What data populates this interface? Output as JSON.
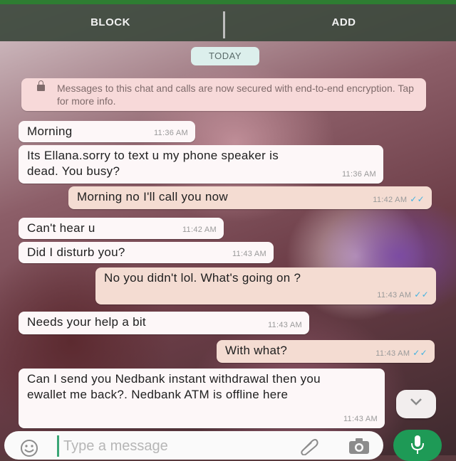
{
  "topbar": {
    "block_label": "BLOCK",
    "add_label": "ADD"
  },
  "date_chip": "TODAY",
  "encryption_notice": "Messages to this chat and calls are now secured with end-to-end encryption. Tap for more info.",
  "messages": [
    {
      "direction": "incoming",
      "text": "Morning",
      "time": "11:36 AM"
    },
    {
      "direction": "incoming",
      "text": "Its Ellana.sorry to text u my phone speaker is dead. You busy?",
      "time": "11:36 AM"
    },
    {
      "direction": "outgoing",
      "text": "Morning no I'll call you now",
      "time": "11:42 AM",
      "ticks": "✓✓"
    },
    {
      "direction": "incoming",
      "text": "Can't hear u",
      "time": "11:42 AM"
    },
    {
      "direction": "incoming",
      "text": "Did I disturb you?",
      "time": "11:43 AM"
    },
    {
      "direction": "outgoing",
      "text": "No you didn't lol. What's going on ?",
      "time": "11:43 AM",
      "ticks": "✓✓"
    },
    {
      "direction": "incoming",
      "text": "Needs your help a bit",
      "time": "11:43 AM"
    },
    {
      "direction": "outgoing",
      "text": "With what?",
      "time": "11:43 AM",
      "ticks": "✓✓"
    },
    {
      "direction": "incoming",
      "text": "Can I send you Nedbank instant withdrawal then you ewallet me back?. Nedbank ATM is offline here",
      "time": "11:43 AM"
    }
  ],
  "composer": {
    "placeholder": "Type a message"
  },
  "icons": {
    "lock": "lock-icon",
    "emoji": "emoji-icon",
    "attach": "paperclip-icon",
    "camera": "camera-icon",
    "mic": "mic-icon",
    "scroll_down": "chevron-down-icon"
  },
  "colors": {
    "topbar_accent": "#2e7d32",
    "incoming_bubble": "#fdf7f8",
    "outgoing_bubble": "#f4dcd2",
    "read_ticks": "#45b3e0",
    "mic_button": "#1e9a56"
  }
}
